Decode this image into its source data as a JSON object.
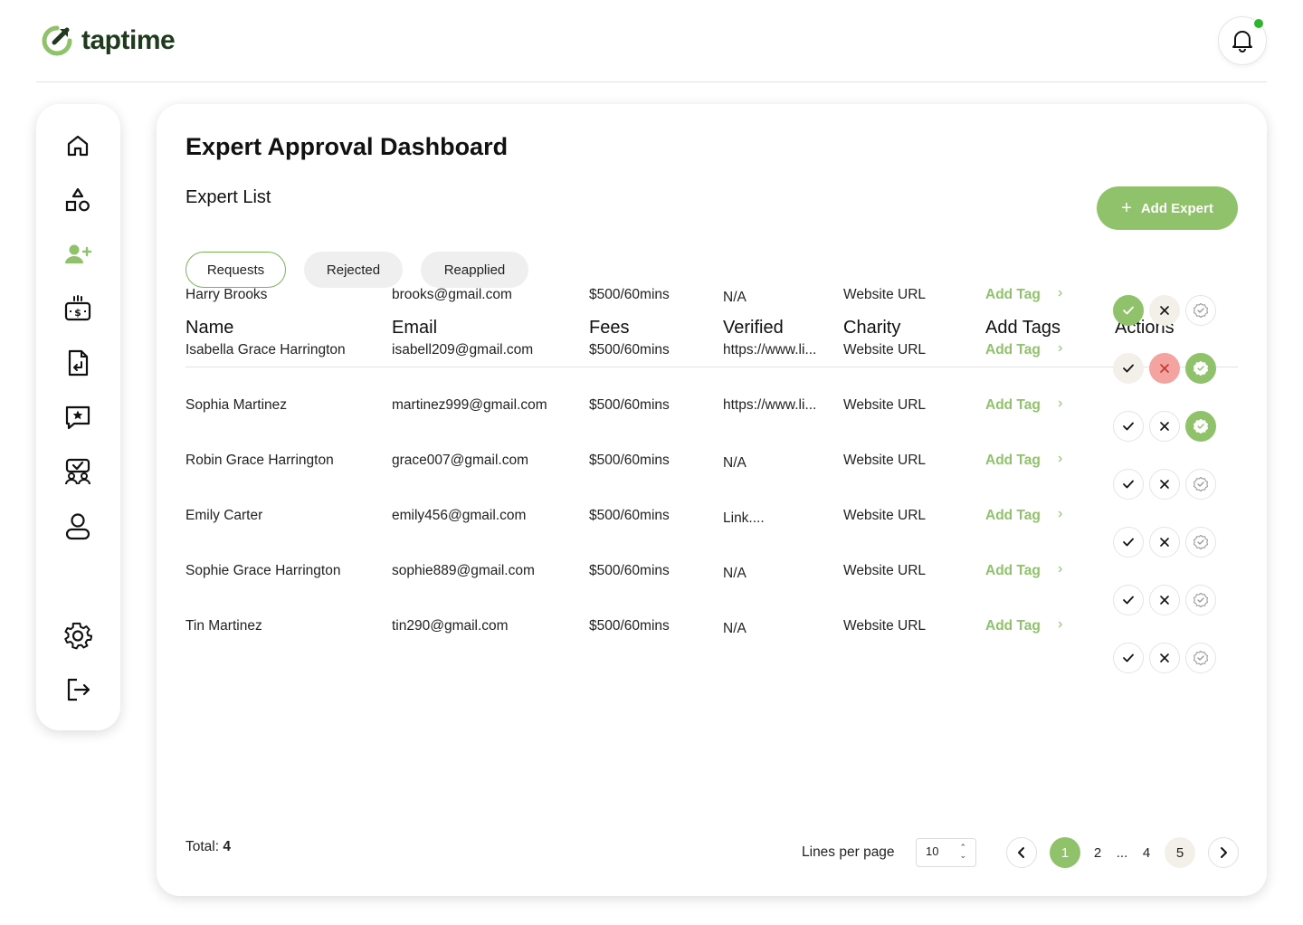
{
  "brand": {
    "name": "taptime",
    "accent": "#8fc26a",
    "dark": "#1f3a1d"
  },
  "header": {
    "notification_icon": "bell-icon",
    "notification_dot_color": "#2db52d"
  },
  "sidebar": {
    "items": [
      {
        "name": "home",
        "icon": "home-icon"
      },
      {
        "name": "categories",
        "icon": "shapes-icon"
      },
      {
        "name": "expert-approval",
        "icon": "user-plus-icon",
        "active": true
      },
      {
        "name": "payments",
        "icon": "money-icon"
      },
      {
        "name": "documents",
        "icon": "document-return-icon"
      },
      {
        "name": "reviews",
        "icon": "star-message-icon"
      },
      {
        "name": "sessions",
        "icon": "group-check-icon"
      },
      {
        "name": "profile",
        "icon": "user-icon"
      },
      {
        "name": "settings",
        "icon": "gear-icon"
      },
      {
        "name": "logout",
        "icon": "logout-icon"
      }
    ]
  },
  "main": {
    "title": "Expert Approval Dashboard",
    "section_title": "Expert List",
    "add_button_label": "Add Expert",
    "tabs": [
      {
        "label": "Requests",
        "active": true
      },
      {
        "label": "Rejected",
        "active": false
      },
      {
        "label": "Reapplied",
        "active": false
      }
    ],
    "columns": [
      "Name",
      "Email",
      "Fees",
      "Verified",
      "Charity",
      "Add Tags",
      "Actions"
    ],
    "rows": [
      {
        "name": "Harry Brooks",
        "email": "brooks@gmail.com",
        "fees": "$500/60mins",
        "verified": "N/A",
        "charity": "Website URL",
        "tag": "Add Tag",
        "state": "approved"
      },
      {
        "name": "Isabella Grace Harrington",
        "email": "isabell209@gmail.com",
        "fees": "$500/60mins",
        "verified": "https://www.li...",
        "charity": "Website URL",
        "tag": "Add Tag",
        "state": "rejected-verified"
      },
      {
        "name": "Sophia Martinez",
        "email": "martinez999@gmail.com",
        "fees": "$500/60mins",
        "verified": "https://www.li...",
        "charity": "Website URL",
        "tag": "Add Tag",
        "state": "verified"
      },
      {
        "name": "Robin Grace Harrington",
        "email": "grace007@gmail.com",
        "fees": "$500/60mins",
        "verified": "N/A",
        "charity": "Website URL",
        "tag": "Add Tag",
        "state": "none"
      },
      {
        "name": "Emily Carter",
        "email": "emily456@gmail.com",
        "fees": "$500/60mins",
        "verified": "Link....",
        "charity": "Website URL",
        "tag": "Add Tag",
        "state": "none"
      },
      {
        "name": "Sophie Grace Harrington",
        "email": "sophie889@gmail.com",
        "fees": "$500/60mins",
        "verified": "N/A",
        "charity": "Website URL",
        "tag": "Add Tag",
        "state": "none"
      },
      {
        "name": "Tin Martinez",
        "email": "tin290@gmail.com",
        "fees": "$500/60mins",
        "verified": "N/A",
        "charity": "Website URL",
        "tag": "Add Tag",
        "state": "none"
      }
    ],
    "footer": {
      "total_label": "Total:",
      "total_value": "4",
      "lines_per_page_label": "Lines per page",
      "lines_per_page_value": "10",
      "pages": [
        "1",
        "2",
        "...",
        "4",
        "5"
      ],
      "current_page": "1"
    }
  }
}
